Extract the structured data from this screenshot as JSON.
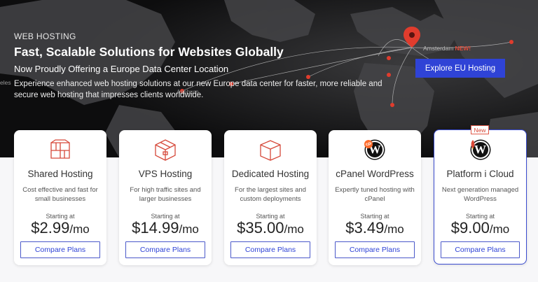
{
  "hero": {
    "eyebrow": "WEB HOSTING",
    "headline": "Fast, Scalable Solutions for Websites Globally",
    "subhead": "Now Proudly Offering a Europe Data Center Location",
    "description": "Experience enhanced web hosting solutions at our new Europe data center for faster, more reliable and secure web hosting that impresses clients worldwide.",
    "cta_label": "Explore EU Hosting",
    "map_labels": {
      "amsterdam": "Amsterdam",
      "amsterdam_new": "NEW!",
      "ashburn": "Ashburn",
      "left": "eles"
    }
  },
  "colors": {
    "accent": "#2f43d6",
    "badge_red": "#d94836",
    "map_red": "#e03c2d"
  },
  "cards": [
    {
      "icon": "box-icon",
      "title": "Shared Hosting",
      "description": "Cost effective and fast for small businesses",
      "starting": "Starting at",
      "price": "$2.99",
      "period": "/mo",
      "button": "Compare Plans"
    },
    {
      "icon": "cube-icon",
      "title": "VPS Hosting",
      "description": "For high traffic sites and larger businesses",
      "starting": "Starting at",
      "price": "$14.99",
      "period": "/mo",
      "button": "Compare Plans"
    },
    {
      "icon": "server-box-icon",
      "title": "Dedicated Hosting",
      "description": "For the largest sites and custom deployments",
      "starting": "Starting at",
      "price": "$35.00",
      "period": "/mo",
      "button": "Compare Plans"
    },
    {
      "icon": "cpanel-wordpress-icon",
      "title": "cPanel WordPress",
      "description": "Expertly tuned hosting with cPanel",
      "starting": "Starting at",
      "price": "$3.49",
      "period": "/mo",
      "button": "Compare Plans",
      "icon_badge": "cP",
      "icon_letter": "W"
    },
    {
      "icon": "wordpress-icon",
      "title": "Platform i Cloud",
      "description": "Next generation managed WordPress",
      "starting": "Starting at",
      "price": "$9.00",
      "period": "/mo",
      "button": "Compare Plans",
      "tag": "New",
      "icon_letter": "W"
    }
  ]
}
